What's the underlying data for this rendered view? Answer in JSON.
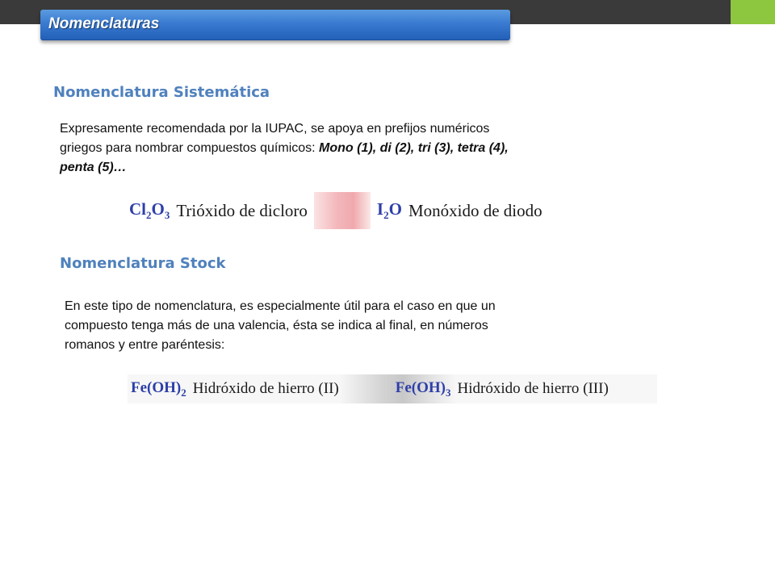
{
  "header": {
    "title": "Nomenclaturas",
    "bar_color": "#3a3a3a",
    "accent_color": "#8dc63f",
    "banner_color": "#3a7bd1"
  },
  "sistematica": {
    "heading": "Nomenclatura Sistemática",
    "paragraph_lines": [
      "Expresamente recomendada por la IUPAC,  se apoya en prefijos numéricos",
      "griegos para nombrar compuestos químicos: "
    ],
    "examples_line2": "Mono (1), di (2), tri (3), tetra (4),",
    "examples_line3": "penta (5)…",
    "examples": [
      {
        "el1": "Cl",
        "sub1": "2",
        "el2": "O",
        "sub2": "3",
        "name": "Trióxido de dicloro"
      },
      {
        "el1": "I",
        "sub1": "2",
        "el2": "O",
        "sub2": "",
        "name": "Monóxido de diodo"
      }
    ]
  },
  "stock": {
    "heading": "Nomenclatura Stock",
    "paragraph_lines": [
      "En este tipo de nomenclatura, es especialmente útil para el caso en que un",
      "compuesto tenga más de una valencia, ésta se indica al final, en números",
      "romanos y entre paréntesis:"
    ],
    "examples": [
      {
        "formula": "Fe(OH)",
        "sub": "2",
        "name": "Hidróxido de hierro (II)"
      },
      {
        "formula": "Fe(OH)",
        "sub": "3",
        "name": "Hidróxido de hierro (III)"
      }
    ]
  },
  "colors": {
    "heading": "#4f81bd",
    "formula": "#2e3fa8",
    "blur_pink": "#f3b8bc",
    "blur_gray": "#d4d4d4"
  }
}
